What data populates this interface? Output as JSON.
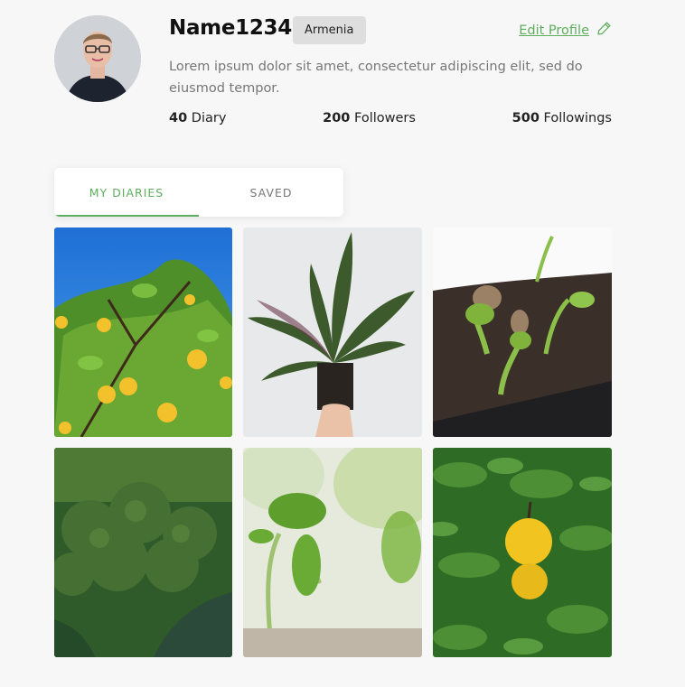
{
  "profile": {
    "username": "Name1234",
    "country": "Armenia",
    "edit_label": "Edit Profile",
    "bio": "Lorem ipsum dolor sit amet, consectetur adipiscing elit, sed do eiusmod tempor."
  },
  "stats": {
    "diary_count": "40",
    "diary_label": "Diary",
    "followers_count": "200",
    "followers_label": "Followers",
    "followings_count": "500",
    "followings_label": "Followings"
  },
  "tabs": [
    {
      "label": "MY DIARIES",
      "active": true
    },
    {
      "label": "SAVED",
      "active": false
    }
  ],
  "colors": {
    "accent": "#5fae5f",
    "badge_bg": "#dedede",
    "page_bg": "#f7f7f7"
  },
  "icons": {
    "edit": "pencil-icon"
  }
}
